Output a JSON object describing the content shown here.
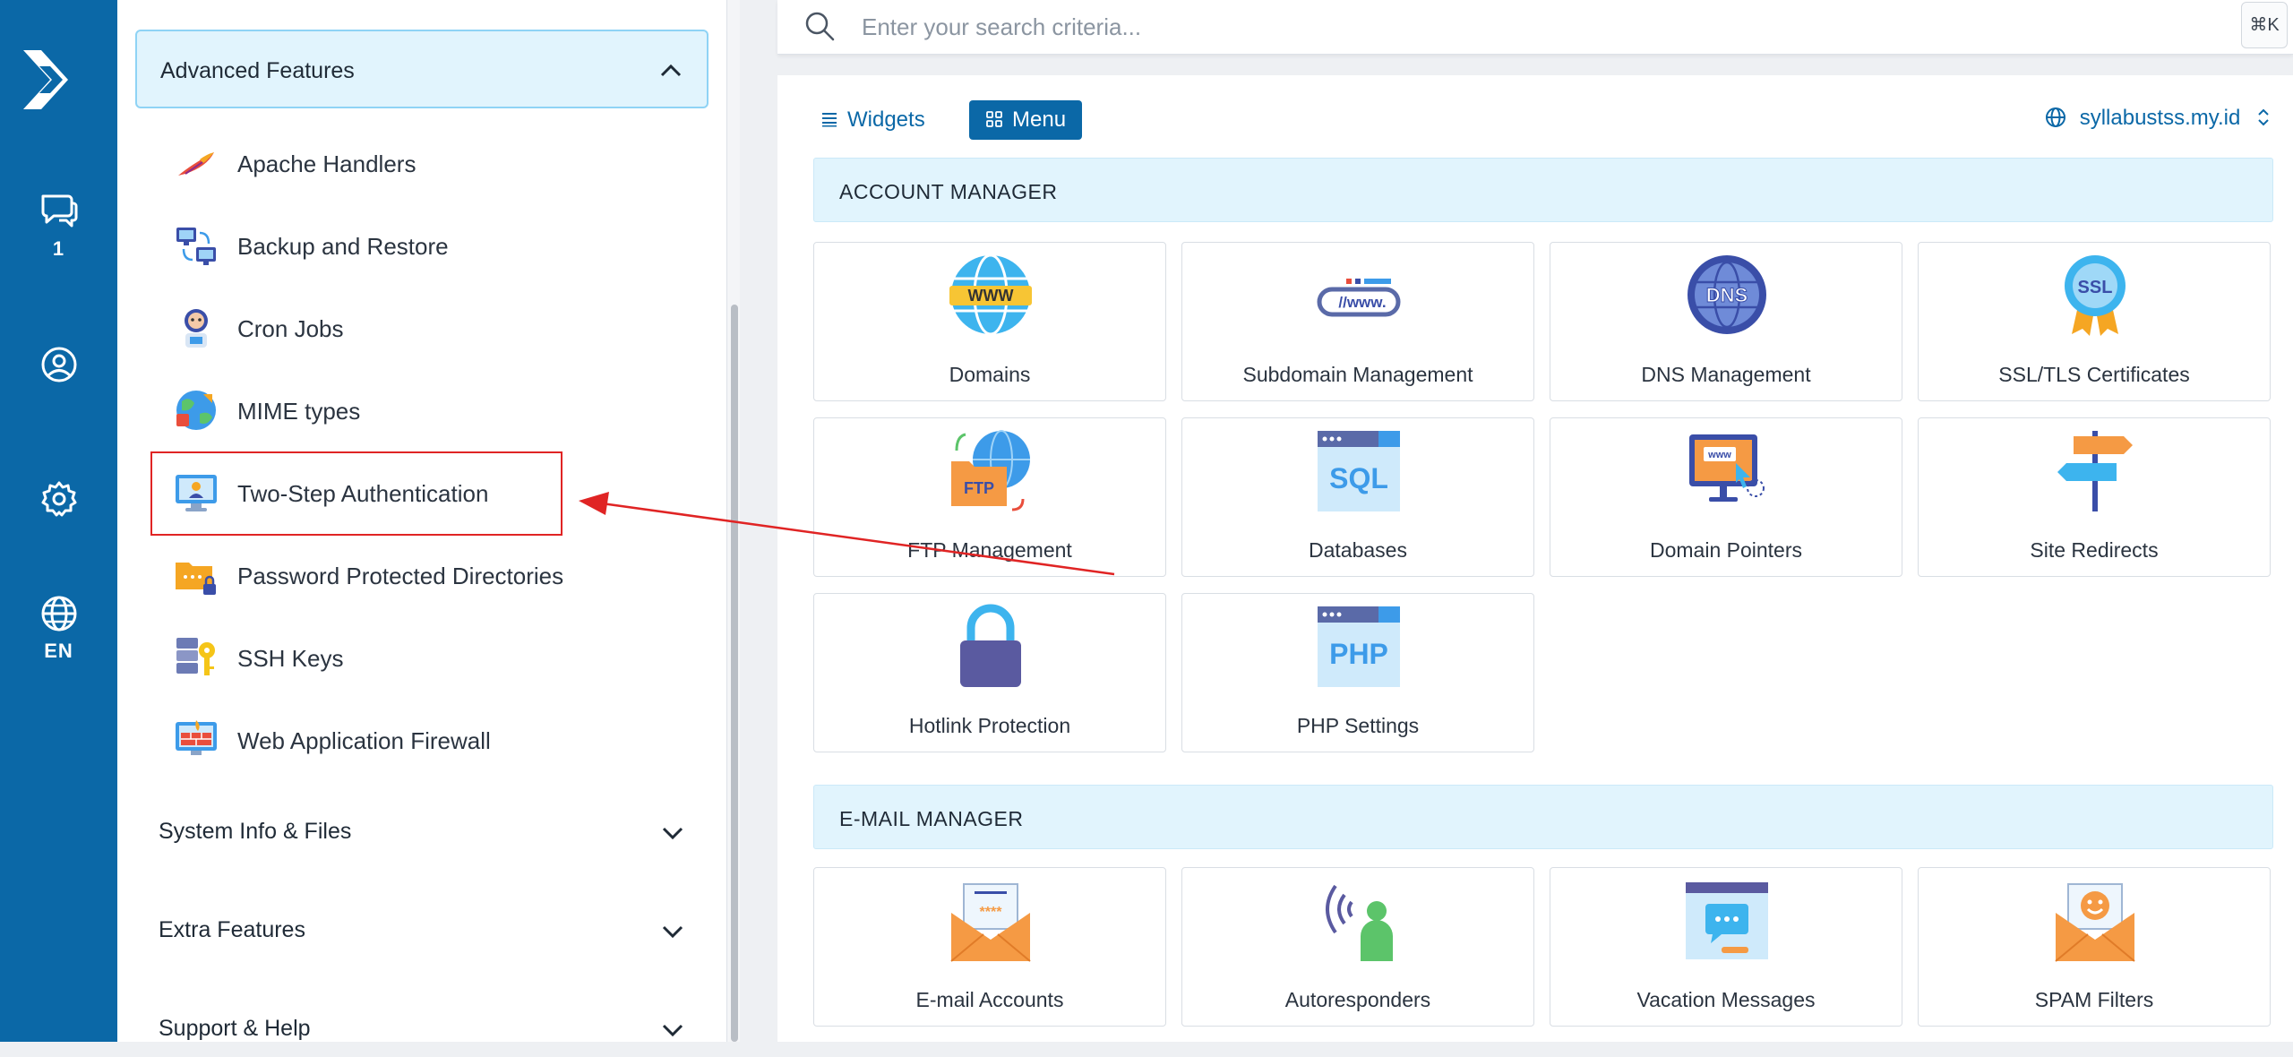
{
  "rail": {
    "messages_count": "1",
    "language": "EN"
  },
  "sidebar": {
    "open_section": "Advanced Features",
    "items": [
      {
        "label": "Apache Handlers",
        "icon": "feather-icon"
      },
      {
        "label": "Backup and Restore",
        "icon": "backup-computers-icon"
      },
      {
        "label": "Cron Jobs",
        "icon": "robot-clock-icon"
      },
      {
        "label": "MIME types",
        "icon": "mime-globe-icon"
      },
      {
        "label": "Two-Step Authentication",
        "icon": "two-step-auth-icon"
      },
      {
        "label": "Password Protected Directories",
        "icon": "locked-folder-icon"
      },
      {
        "label": "SSH Keys",
        "icon": "ssh-key-icon"
      },
      {
        "label": "Web Application Firewall",
        "icon": "firewall-icon"
      }
    ],
    "collapsed_sections": [
      "System Info & Files",
      "Extra Features",
      "Support & Help"
    ]
  },
  "search": {
    "placeholder": "Enter your search criteria...",
    "shortcut": "⌘K"
  },
  "toolbar": {
    "widgets_label": "Widgets",
    "menu_label": "Menu",
    "domain": "syllabustss.my.id"
  },
  "sections": [
    {
      "title": "ACCOUNT MANAGER",
      "cards": [
        {
          "label": "Domains",
          "icon": "www-globe-icon"
        },
        {
          "label": "Subdomain Management",
          "icon": "subdomain-icon"
        },
        {
          "label": "DNS Management",
          "icon": "dns-globe-icon"
        },
        {
          "label": "SSL/TLS Certificates",
          "icon": "ssl-badge-icon"
        },
        {
          "label": "FTP Management",
          "icon": "ftp-folder-icon"
        },
        {
          "label": "Databases",
          "icon": "sql-window-icon"
        },
        {
          "label": "Domain Pointers",
          "icon": "domain-pointer-monitor-icon"
        },
        {
          "label": "Site Redirects",
          "icon": "signpost-icon"
        },
        {
          "label": "Hotlink Protection",
          "icon": "padlock-icon"
        },
        {
          "label": "PHP Settings",
          "icon": "php-window-icon"
        }
      ]
    },
    {
      "title": "E-MAIL MANAGER",
      "cards": [
        {
          "label": "E-mail Accounts",
          "icon": "email-password-icon"
        },
        {
          "label": "Autoresponders",
          "icon": "autoresponder-icon"
        },
        {
          "label": "Vacation Messages",
          "icon": "vacation-message-icon"
        },
        {
          "label": "SPAM Filters",
          "icon": "spam-filter-icon"
        }
      ]
    }
  ],
  "colors": {
    "brand": "#0b68a7",
    "section_bg": "#e1f4fd",
    "highlight": "#e02424"
  }
}
